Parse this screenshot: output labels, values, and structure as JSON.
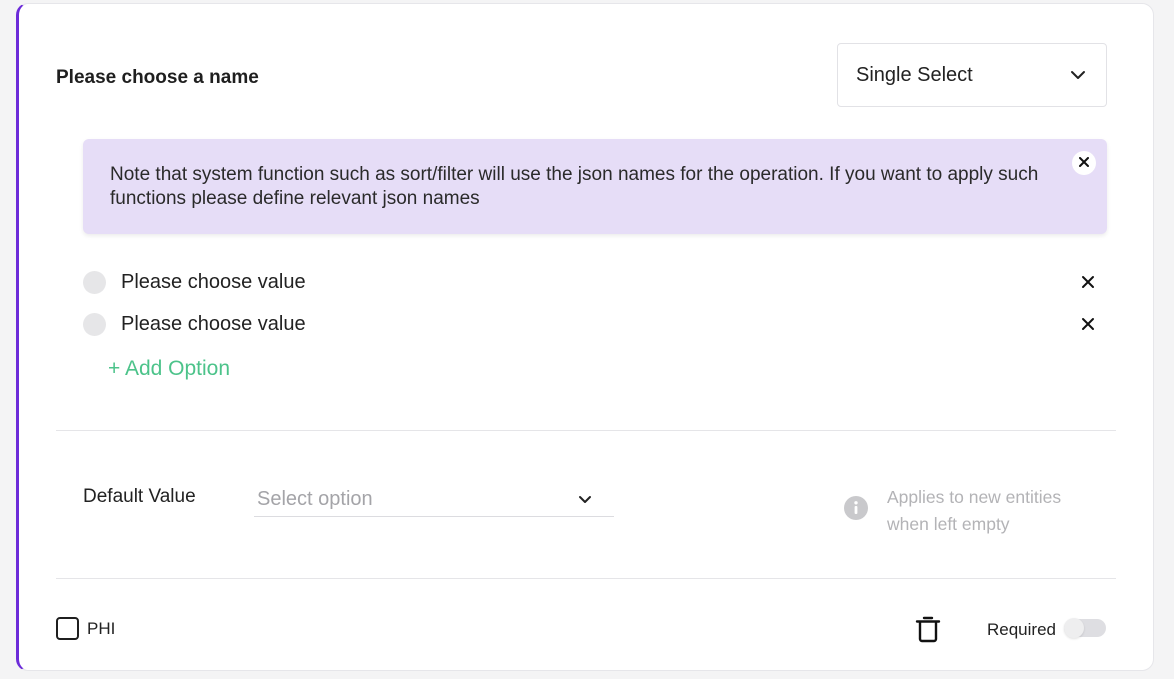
{
  "field": {
    "name_label": "Please choose a name",
    "type_select": {
      "value": "Single Select",
      "icon": "chevron-down-icon"
    }
  },
  "note": {
    "text": "Note that system function such as sort/filter will use the json names for the operation. If you want to apply such functions please define relevant json names",
    "close_icon": "close-icon"
  },
  "options": [
    {
      "label": "Please choose value",
      "remove_icon": "close-icon"
    },
    {
      "label": "Please choose value",
      "remove_icon": "close-icon"
    }
  ],
  "add_option_label": "+ Add Option",
  "default_value": {
    "label": "Default Value",
    "placeholder": "Select option",
    "info_text": "Applies to new entities when left empty",
    "info_icon": "info-icon"
  },
  "footer": {
    "phi_label": "PHI",
    "phi_checked": false,
    "delete_icon": "trash-icon",
    "required_label": "Required",
    "required_on": false
  },
  "colors": {
    "accent": "#6c2bd9",
    "note_bg": "#e6ddf7",
    "add_option": "#4cc38a",
    "placeholder": "#a4a4a8"
  }
}
